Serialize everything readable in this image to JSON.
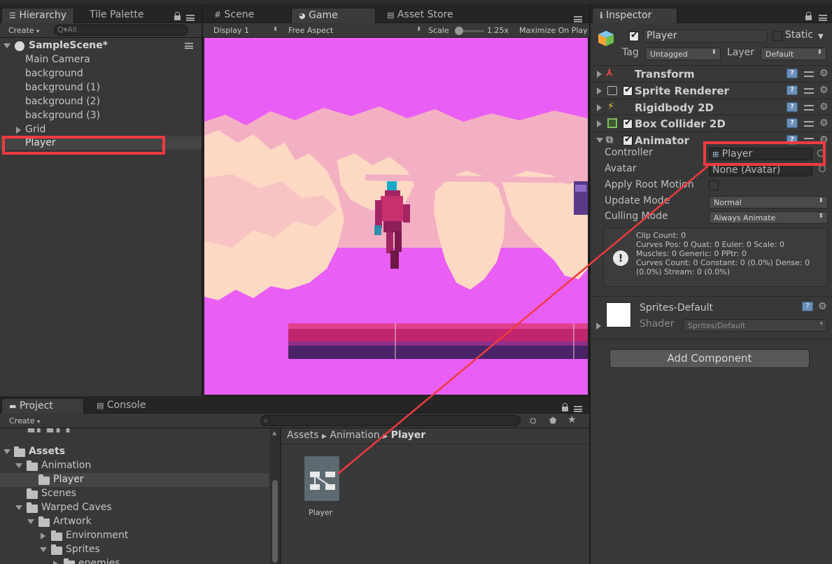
{
  "hierarchy": {
    "tabs": [
      "Hierarchy",
      "Tile Palette"
    ],
    "create_label": "Create",
    "search_placeholder": "Q▾All",
    "scene_name": "SampleScene*",
    "items": [
      "Main Camera",
      "background",
      "background (1)",
      "background (2)",
      "background (3)",
      "Grid",
      "Player"
    ],
    "selected_item": "Player"
  },
  "center": {
    "tabs": [
      "Scene",
      "Game",
      "Asset Store"
    ],
    "display": "Display 1",
    "aspect": "Free Aspect",
    "scale_label": "Scale",
    "scale_value": "1.25x",
    "maximize": "Maximize On Play"
  },
  "inspector": {
    "tab": "Inspector",
    "object_name": "Player",
    "static_label": "Static",
    "tag_label": "Tag",
    "tag_value": "Untagged",
    "layer_label": "Layer",
    "layer_value": "Default",
    "components": [
      "Transform",
      "Sprite Renderer",
      "Rigidbody 2D",
      "Box Collider 2D",
      "Animator"
    ],
    "animator": {
      "controller_label": "Controller",
      "controller_value": "Player",
      "avatar_label": "Avatar",
      "avatar_value": "None (Avatar)",
      "apply_root_motion_label": "Apply Root Motion",
      "update_mode_label": "Update Mode",
      "update_mode_value": "Normal",
      "culling_mode_label": "Culling Mode",
      "culling_mode_value": "Always Animate",
      "info_lines": [
        "Clip Count: 0",
        "Curves Pos: 0 Quat: 0 Euler: 0 Scale: 0",
        "Muscles: 0 Generic: 0 PPtr: 0",
        "Curves Count: 0 Constant: 0 (0.0%) Dense: 0",
        "(0.0%) Stream: 0 (0.0%)"
      ]
    },
    "material": {
      "name": "Sprites-Default",
      "shader_label": "Shader",
      "shader_value": "Sprites/Default"
    },
    "add_component": "Add Component"
  },
  "project": {
    "tabs": [
      "Project",
      "Console"
    ],
    "create_label": "Create",
    "breadcrumb": [
      "Assets",
      "Animation",
      "Player"
    ],
    "tree": [
      {
        "label": "Assets",
        "depth": 0,
        "state": "open",
        "bold": true
      },
      {
        "label": "Animation",
        "depth": 1,
        "state": "open"
      },
      {
        "label": "Player",
        "depth": 2,
        "state": "leaf",
        "selected": true
      },
      {
        "label": "Scenes",
        "depth": 1,
        "state": "leaf"
      },
      {
        "label": "Warped Caves",
        "depth": 1,
        "state": "open"
      },
      {
        "label": "Artwork",
        "depth": 2,
        "state": "open"
      },
      {
        "label": "Environment",
        "depth": 3,
        "state": "closed"
      },
      {
        "label": "Sprites",
        "depth": 3,
        "state": "open"
      },
      {
        "label": "enemies",
        "depth": 4,
        "state": "closed"
      }
    ],
    "asset_label": "Player"
  },
  "colors": {
    "annotation": "#ef3a3f",
    "game_bg": "#e95ef4",
    "foliage_light": "#fdd9c4",
    "foliage_mid": "#f4b0c3",
    "ground": "#c0256e"
  }
}
